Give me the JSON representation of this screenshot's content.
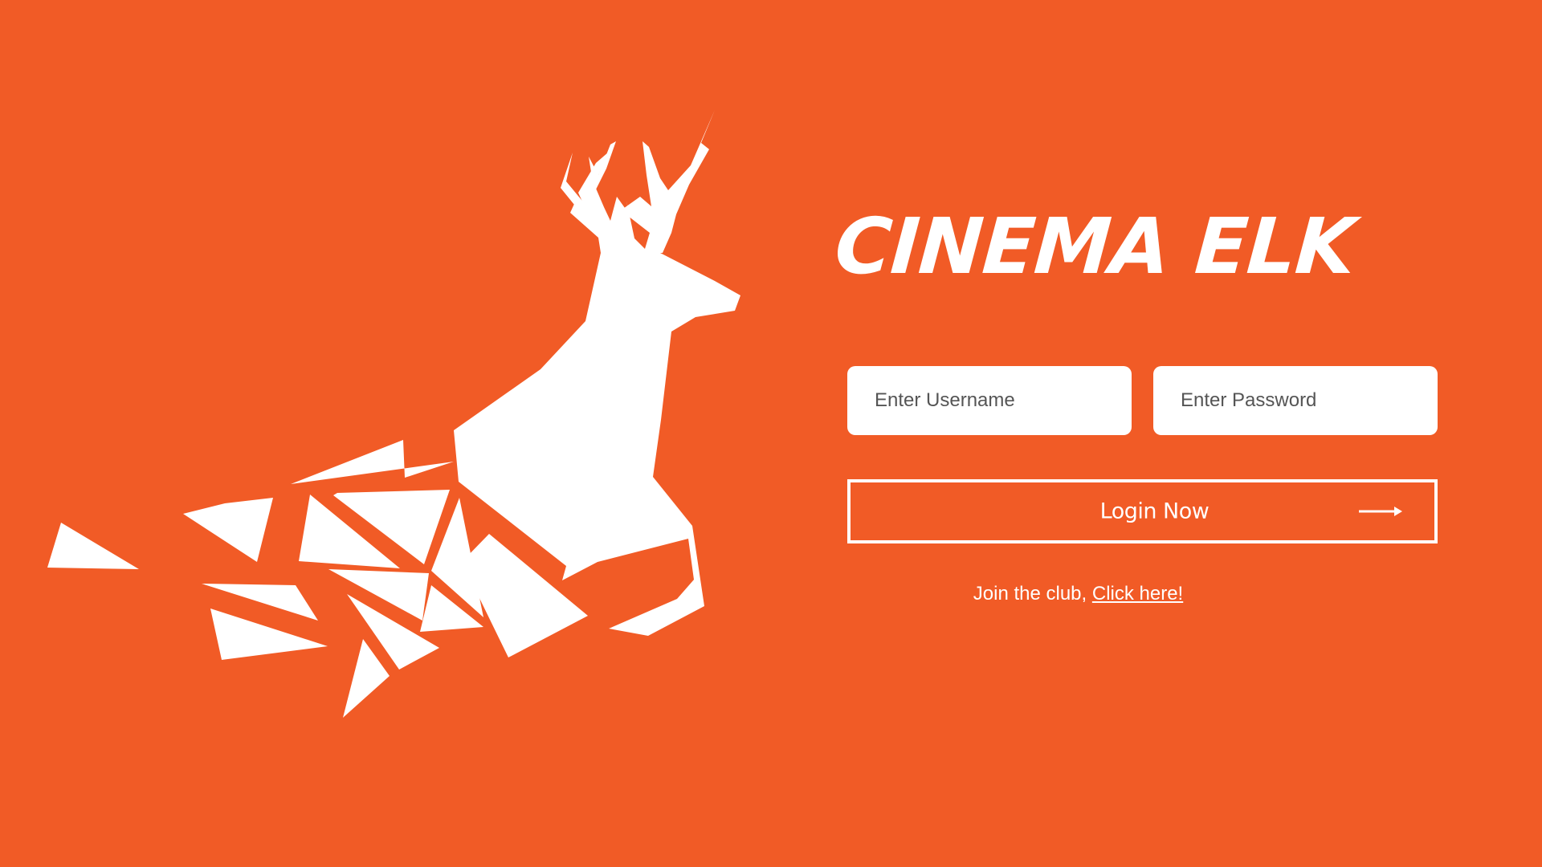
{
  "brand": {
    "title": "CINEMA ELK"
  },
  "login_form": {
    "username_placeholder": "Enter Username",
    "password_placeholder": "Enter Password",
    "login_button_label": "Login Now",
    "arrow_icon": "arrow-right-icon"
  },
  "signup": {
    "prompt": "Join the club, ",
    "link_label": "Click here!"
  },
  "logo": {
    "icon": "elk-logo-icon"
  },
  "colors": {
    "background": "#F15B26",
    "foreground": "#FFFFFF"
  }
}
